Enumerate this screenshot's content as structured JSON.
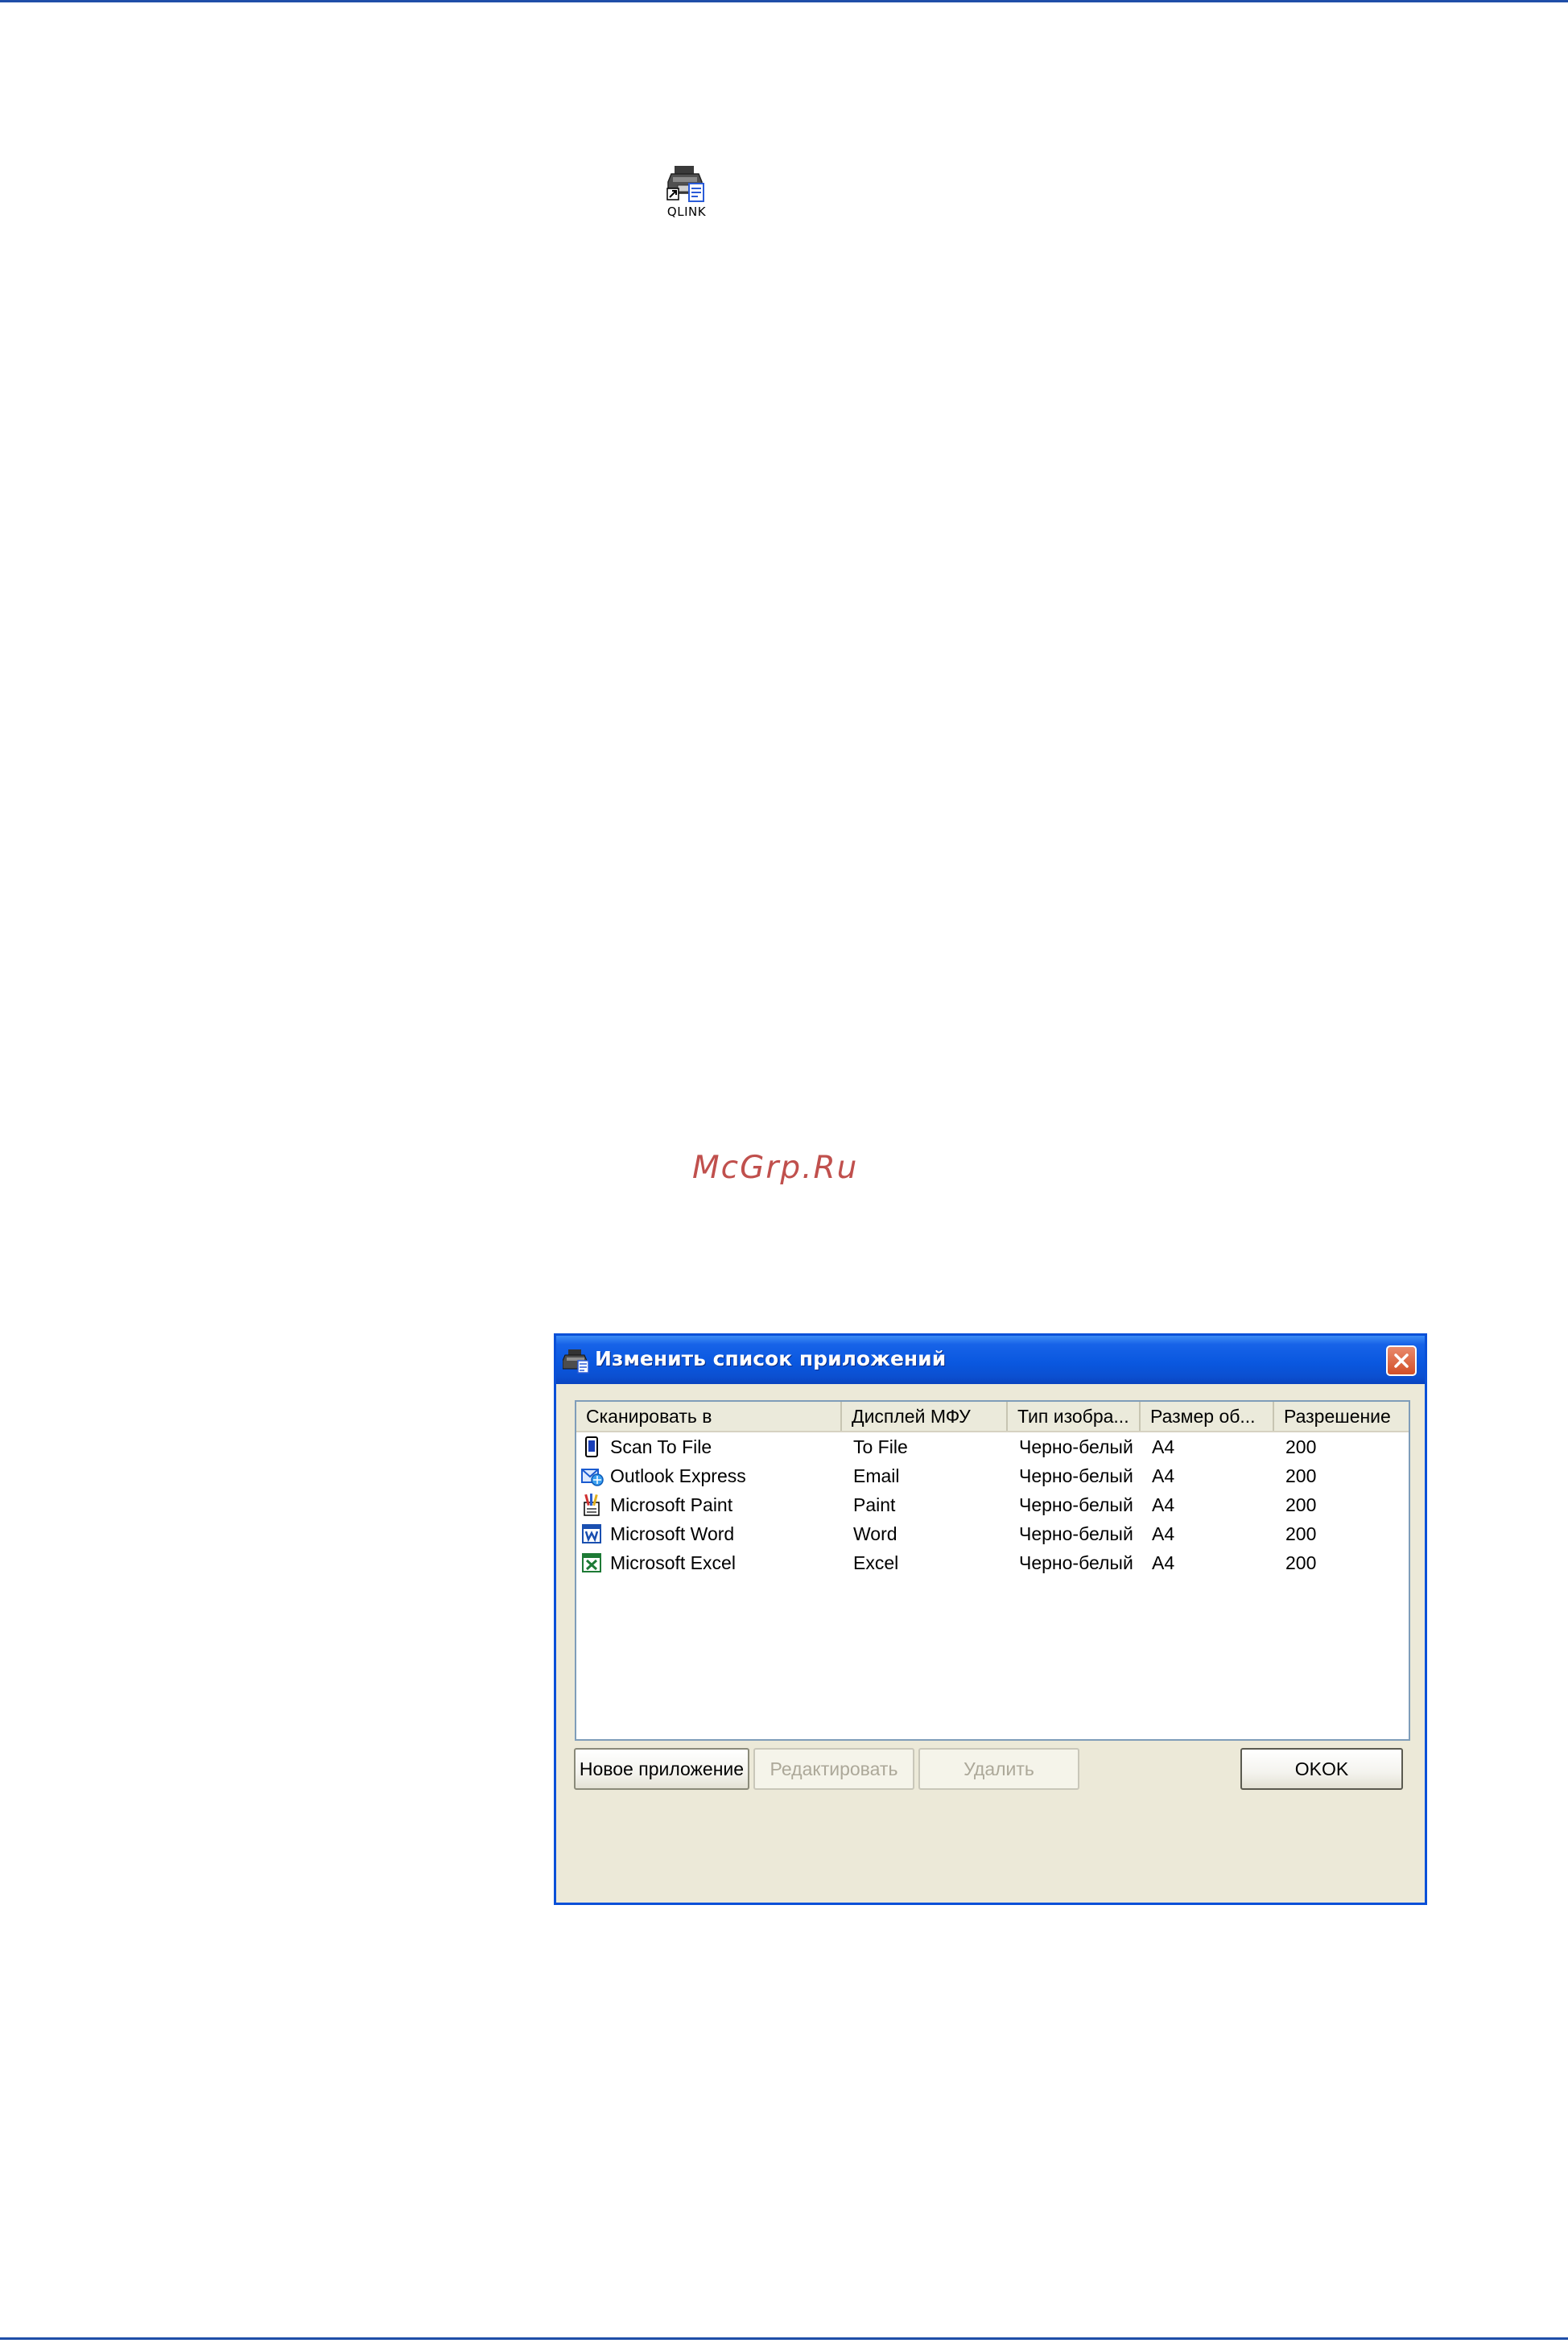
{
  "desktop_icon": {
    "label": "QLINK",
    "icon": "qlink-printer-shortcut-icon"
  },
  "watermark": "McGrp.Ru",
  "dialog": {
    "title": "Изменить список приложений",
    "title_icon": "qlink-app-icon",
    "columns": [
      "Сканировать в",
      "Дисплей МФУ",
      "Тип изобра...",
      "Размер об...",
      "Разрешение"
    ],
    "rows": [
      {
        "icon": "scan-to-file-icon",
        "name": "Scan To File",
        "display": "To File",
        "type": "Черно-белый",
        "size": "A4",
        "resolution": "200"
      },
      {
        "icon": "outlook-express-icon",
        "name": "Outlook Express",
        "display": "Email",
        "type": "Черно-белый",
        "size": "A4",
        "resolution": "200"
      },
      {
        "icon": "ms-paint-icon",
        "name": "Microsoft Paint",
        "display": "Paint",
        "type": "Черно-белый",
        "size": "A4",
        "resolution": "200"
      },
      {
        "icon": "ms-word-icon",
        "name": "Microsoft Word",
        "display": "Word",
        "type": "Черно-белый",
        "size": "A4",
        "resolution": "200"
      },
      {
        "icon": "ms-excel-icon",
        "name": "Microsoft Excel",
        "display": "Excel",
        "type": "Черно-белый",
        "size": "A4",
        "resolution": "200"
      }
    ],
    "buttons": {
      "new_app": "Новое приложение",
      "edit": "Редактировать",
      "delete": "Удалить",
      "ok": "OKOK"
    }
  },
  "colors": {
    "rule": "#1f4ea8",
    "titlebar": "#0a58e0",
    "dialog_bg": "#ece9d8",
    "close": "#d24f28",
    "watermark": "#c0504d"
  }
}
